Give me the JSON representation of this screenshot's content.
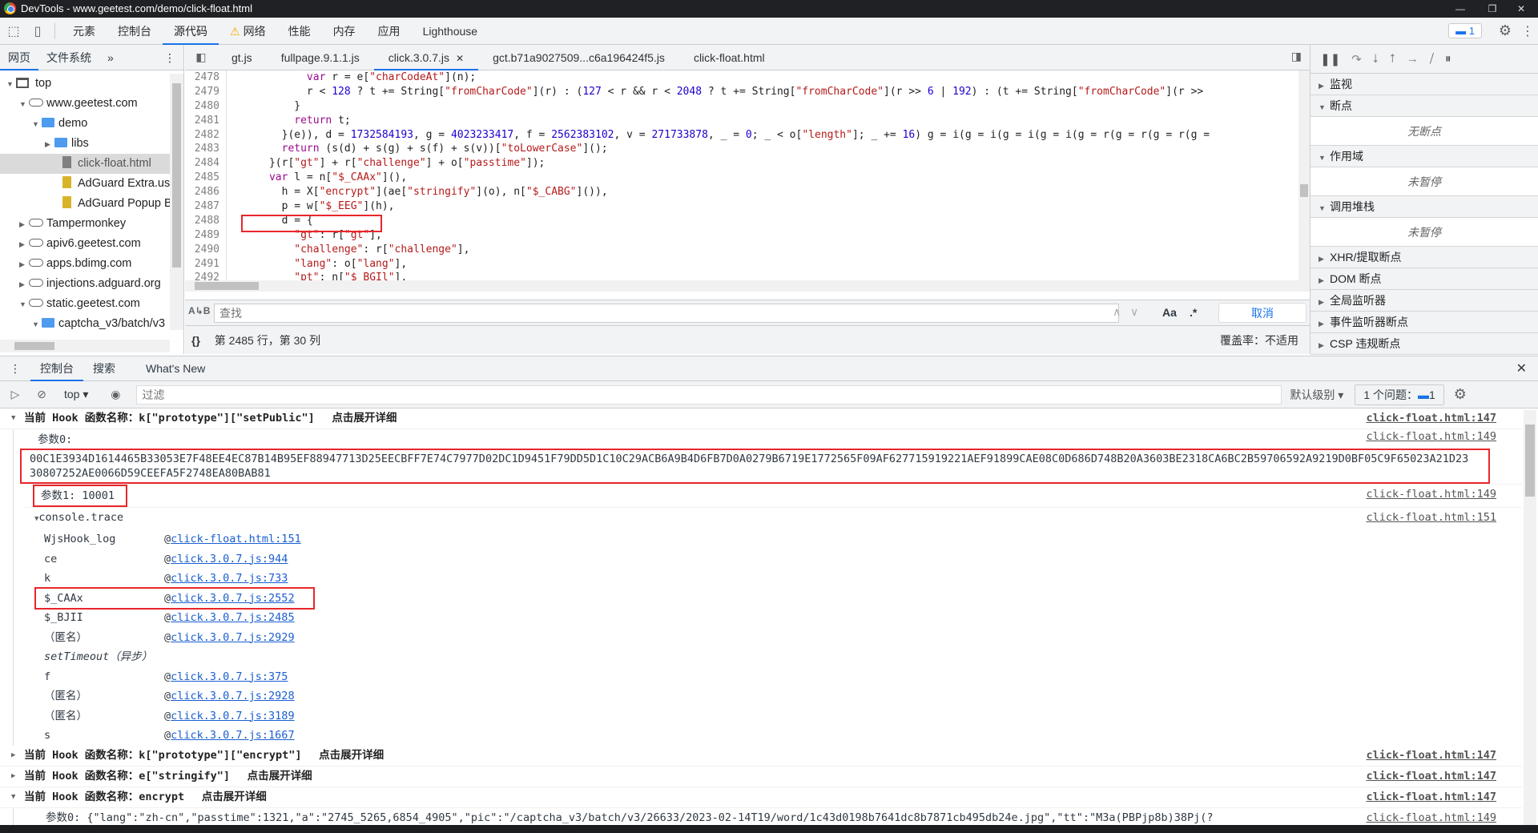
{
  "window": {
    "title": "DevTools - www.geetest.com/demo/click-float.html",
    "minimize": "—",
    "restore": "❐",
    "close": "✕"
  },
  "main_tabs": [
    "元素",
    "控制台",
    "源代码",
    "网络",
    "性能",
    "内存",
    "应用",
    "Lighthouse"
  ],
  "main_active": 2,
  "warning_tab": 3,
  "issues_badge": "1",
  "nav": {
    "tabs": [
      "网页",
      "文件系统"
    ],
    "more": "»",
    "tree": [
      {
        "label": "top",
        "depth": 0,
        "tw": "▼",
        "icon": "frame"
      },
      {
        "label": "www.geetest.com",
        "depth": 1,
        "tw": "▼",
        "icon": "cloud"
      },
      {
        "label": "demo",
        "depth": 2,
        "tw": "▼",
        "icon": "folder"
      },
      {
        "label": "libs",
        "depth": 3,
        "tw": "▶",
        "icon": "folder"
      },
      {
        "label": "click-float.html",
        "depth": 3,
        "tw": "",
        "icon": "file-gray",
        "selected": true
      },
      {
        "label": "AdGuard Extra.user.js",
        "depth": 3,
        "tw": "",
        "icon": "file-yellow"
      },
      {
        "label": "AdGuard Popup Blocker",
        "depth": 3,
        "tw": "",
        "icon": "file-yellow"
      },
      {
        "label": "Tampermonkey",
        "depth": 1,
        "tw": "▶",
        "icon": "cloud"
      },
      {
        "label": "apiv6.geetest.com",
        "depth": 1,
        "tw": "▶",
        "icon": "cloud"
      },
      {
        "label": "apps.bdimg.com",
        "depth": 1,
        "tw": "▶",
        "icon": "cloud"
      },
      {
        "label": "injections.adguard.org",
        "depth": 1,
        "tw": "▶",
        "icon": "cloud"
      },
      {
        "label": "static.geetest.com",
        "depth": 1,
        "tw": "▼",
        "icon": "cloud"
      },
      {
        "label": "captcha_v3/batch/v3",
        "depth": 2,
        "tw": "▼",
        "icon": "folder"
      }
    ]
  },
  "file_tabs": [
    {
      "label": "gt.js"
    },
    {
      "label": "fullpage.9.1.1.js"
    },
    {
      "label": "click.3.0.7.js",
      "active": true,
      "closable": "✕"
    },
    {
      "label": "gct.b71a9027509...c6a196424f5.js"
    },
    {
      "label": "click-float.html"
    }
  ],
  "code": [
    {
      "n": "2478",
      "t": [
        [
          "",
          "            "
        ],
        [
          "kw",
          "var"
        ],
        [
          "",
          " r = e["
        ],
        [
          "str",
          "\"charCodeAt\""
        ],
        [
          "",
          "](n);"
        ]
      ]
    },
    {
      "n": "2479",
      "t": [
        [
          "",
          "            r < "
        ],
        [
          "num",
          "128"
        ],
        [
          "",
          " ? t += String["
        ],
        [
          "str",
          "\"fromCharCode\""
        ],
        [
          "",
          "](r) : ("
        ],
        [
          "num",
          "127"
        ],
        [
          "",
          " < r && r < "
        ],
        [
          "num",
          "2048"
        ],
        [
          "",
          " ? t += String["
        ],
        [
          "str",
          "\"fromCharCode\""
        ],
        [
          "",
          "](r >> "
        ],
        [
          "num",
          "6"
        ],
        [
          "",
          " | "
        ],
        [
          "num",
          "192"
        ],
        [
          "",
          ") : (t += String["
        ],
        [
          "str",
          "\"fromCharCode\""
        ],
        [
          "",
          "](r >>"
        ]
      ]
    },
    {
      "n": "2480",
      "t": [
        [
          "",
          "          }"
        ]
      ]
    },
    {
      "n": "2481",
      "t": [
        [
          "",
          "          "
        ],
        [
          "kw",
          "return"
        ],
        [
          "",
          " t;"
        ]
      ]
    },
    {
      "n": "2482",
      "t": [
        [
          "",
          "        }(e)), d = "
        ],
        [
          "num",
          "1732584193"
        ],
        [
          "",
          ", g = "
        ],
        [
          "num",
          "4023233417"
        ],
        [
          "",
          ", f = "
        ],
        [
          "num",
          "2562383102"
        ],
        [
          "",
          ", v = "
        ],
        [
          "num",
          "271733878"
        ],
        [
          "",
          ", _ = "
        ],
        [
          "num",
          "0"
        ],
        [
          "",
          "; _ < o["
        ],
        [
          "str",
          "\"length\""
        ],
        [
          "",
          "]; _ += "
        ],
        [
          "num",
          "16"
        ],
        [
          "",
          ") g = i(g = i(g = i(g = i(g = r(g = r(g = r(g ="
        ]
      ]
    },
    {
      "n": "2483",
      "t": [
        [
          "",
          "        "
        ],
        [
          "kw",
          "return"
        ],
        [
          "",
          " (s(d) + s(g) + s(f) + s(v))["
        ],
        [
          "str",
          "\"toLowerCase\""
        ],
        [
          "",
          "]();"
        ]
      ]
    },
    {
      "n": "2484",
      "t": [
        [
          "",
          "      }(r["
        ],
        [
          "str",
          "\"gt\""
        ],
        [
          "",
          "] + r["
        ],
        [
          "str",
          "\"challenge\""
        ],
        [
          "",
          "] + o["
        ],
        [
          "str",
          "\"passtime\""
        ],
        [
          "",
          "]);"
        ]
      ]
    },
    {
      "n": "2485",
      "t": [
        [
          "",
          "      "
        ],
        [
          "kw",
          "var"
        ],
        [
          "",
          " l = n["
        ],
        [
          "str",
          "\"$_CAAx\""
        ],
        [
          "",
          "](),"
        ]
      ]
    },
    {
      "n": "2486",
      "t": [
        [
          "",
          "        h = X["
        ],
        [
          "str",
          "\"encrypt\""
        ],
        [
          "",
          "](ae["
        ],
        [
          "str",
          "\"stringify\""
        ],
        [
          "",
          "](o), n["
        ],
        [
          "str",
          "\"$_CABG\""
        ],
        [
          "",
          "]()),"
        ]
      ]
    },
    {
      "n": "2487",
      "t": [
        [
          "",
          "        p = w["
        ],
        [
          "str",
          "\"$_EEG\""
        ],
        [
          "",
          "](h),"
        ]
      ]
    },
    {
      "n": "2488",
      "t": [
        [
          "",
          "        d = {"
        ]
      ]
    },
    {
      "n": "2489",
      "t": [
        [
          "",
          "          "
        ],
        [
          "str",
          "\"gt\""
        ],
        [
          "",
          ": r["
        ],
        [
          "str",
          "\"gt\""
        ],
        [
          "",
          "],"
        ]
      ]
    },
    {
      "n": "2490",
      "t": [
        [
          "",
          "          "
        ],
        [
          "str",
          "\"challenge\""
        ],
        [
          "",
          ": r["
        ],
        [
          "str",
          "\"challenge\""
        ],
        [
          "",
          "],"
        ]
      ]
    },
    {
      "n": "2491",
      "t": [
        [
          "",
          "          "
        ],
        [
          "str",
          "\"lang\""
        ],
        [
          "",
          ": o["
        ],
        [
          "str",
          "\"lang\""
        ],
        [
          "",
          "],"
        ]
      ]
    },
    {
      "n": "2492",
      "t": [
        [
          "",
          "          "
        ],
        [
          "str",
          "\"pt\""
        ],
        [
          "",
          ": n["
        ],
        [
          "str",
          "\"$_BGIl\""
        ],
        [
          "",
          "],"
        ]
      ]
    }
  ],
  "find": {
    "placeholder": "查找",
    "case": "Aa",
    "regex": ".*",
    "cancel": "取消",
    "up": "∧",
    "down": "∨"
  },
  "status": {
    "braces": "{}",
    "position": "第 2485 行，第 30 列",
    "coverage": "覆盖率：不适用"
  },
  "right": {
    "sections": [
      {
        "label": "监视",
        "open": false
      },
      {
        "label": "断点",
        "open": true,
        "body": "无断点"
      },
      {
        "label": "作用域",
        "open": true,
        "body": "未暂停"
      },
      {
        "label": "调用堆栈",
        "open": true,
        "body": "未暂停"
      },
      {
        "label": "XHR/提取断点",
        "open": false
      },
      {
        "label": "DOM 断点",
        "open": false
      },
      {
        "label": "全局监听器",
        "open": false
      },
      {
        "label": "事件监听器断点",
        "open": false
      },
      {
        "label": "CSP 违规断点",
        "open": false
      }
    ]
  },
  "drawer": {
    "tabs": [
      "控制台",
      "搜索",
      "What's New"
    ],
    "close": "✕"
  },
  "console_toolbar": {
    "context": "top",
    "filter_placeholder": "过滤",
    "level": "默认级别",
    "issues": "1 个问题：",
    "issues_count": "1"
  },
  "console": {
    "hook1": {
      "title": "当前 Hook 函数名称：k[\"prototype\"][\"setPublic\"]　 点击展开详细",
      "src": "click-float.html:147"
    },
    "param0_label": "参数0:",
    "param0_src": "click-float.html:149",
    "param0_line1": "00C1E3934D1614465B33053E7F48EE4EC87B14B95EF88947713D25EECBFF7E74C7977D02DC1D9451F79DD5D1C10C29ACB6A9B4D6FB7D0A0279B6719E1772565F09AF627715919221AEF91899CAE08C0D686D748B20A3603BE2318CA6BC2B59706592A9219D0BF05C9F65023A21D23",
    "param0_line2": "30807252AE0066D59CEEFA5F2748EA80BAB81",
    "param1": "参数1:  10001",
    "param1_src": "click-float.html:149",
    "trace_label": "console.trace",
    "trace_src": "click-float.html:151",
    "trace": [
      {
        "fn": "WjsHook_log",
        "link": "click-float.html:151"
      },
      {
        "fn": "ce",
        "link": "click.3.0.7.js:944"
      },
      {
        "fn": "k",
        "link": "click.3.0.7.js:733"
      },
      {
        "fn": "$_CAAx",
        "link": "click.3.0.7.js:2552",
        "highlight": true
      },
      {
        "fn": "$_BJII",
        "link": "click.3.0.7.js:2485"
      },
      {
        "fn": "（匿名）",
        "link": "click.3.0.7.js:2929"
      },
      {
        "fn": "setTimeout（异步）",
        "async": true
      },
      {
        "fn": "f",
        "link": "click.3.0.7.js:375"
      },
      {
        "fn": "（匿名）",
        "link": "click.3.0.7.js:2928"
      },
      {
        "fn": "（匿名）",
        "link": "click.3.0.7.js:3189"
      },
      {
        "fn": "s",
        "link": "click.3.0.7.js:1667"
      }
    ],
    "hooks": [
      {
        "title": "当前 Hook 函数名称：k[\"prototype\"][\"encrypt\"]　 点击展开详细",
        "src": "click-float.html:147",
        "open": false
      },
      {
        "title": "当前 Hook 函数名称：e[\"stringify\"]　 点击展开详细",
        "src": "click-float.html:147",
        "open": false
      },
      {
        "title": "当前 Hook 函数名称：encrypt　 点击展开详细",
        "src": "click-float.html:147",
        "open": true
      }
    ],
    "last_param": "参数0:  {\"lang\":\"zh-cn\",\"passtime\":1321,\"a\":\"2745_5265,6854_4905\",\"pic\":\"/captcha_v3/batch/v3/26633/2023-02-14T19/word/1c43d0198b7641dc8b7871cb495db24e.jpg\",\"tt\":\"M3a(PBPjp8b)38Pj(?",
    "last_src": "click-float.html:149"
  },
  "colors": {
    "accent": "#1a73e8",
    "highlight_box": "#e8262b",
    "keyword": "#9b0a8c",
    "string": "#b51a1a",
    "number": "#1c00cf",
    "link": "#1a5fd0"
  }
}
